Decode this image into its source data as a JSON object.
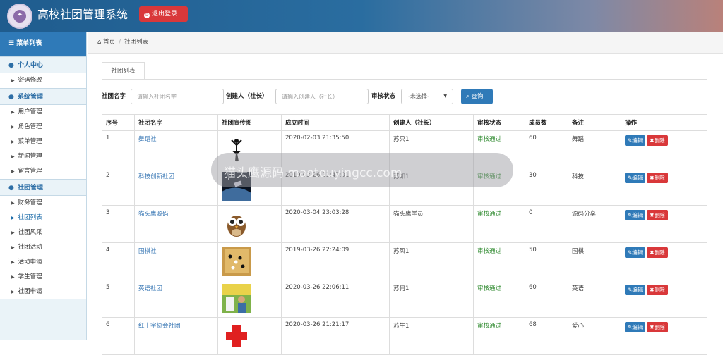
{
  "header": {
    "title": "高校社团管理系统",
    "logout_label": "退出登录"
  },
  "sidebar": {
    "menu_title": "菜单列表",
    "groups": [
      {
        "label": "个人中心",
        "items": [
          "密码修改"
        ]
      },
      {
        "label": "系统管理",
        "items": [
          "用户管理",
          "角色管理",
          "菜单管理",
          "新闻管理",
          "留言管理"
        ]
      },
      {
        "label": "社团管理",
        "items": [
          "财务管理",
          "社团列表",
          "社团风采",
          "社团活动",
          "活动申请",
          "学生管理",
          "社团申请"
        ]
      }
    ]
  },
  "breadcrumb": {
    "home": "首页",
    "current": "社团列表"
  },
  "tab_label": "社团列表",
  "search": {
    "name_label": "社团名字",
    "name_placeholder": "请输入社团名字",
    "creator_label": "创建人（社长）",
    "creator_placeholder": "请输入创建人（社长）",
    "status_label": "审核状态",
    "status_value": "-未选择-",
    "button_label": "查询"
  },
  "table": {
    "headers": [
      "序号",
      "社团名字",
      "社团宣传图",
      "成立时间",
      "创建人（社长）",
      "审核状态",
      "成员数",
      "备注",
      "操作"
    ],
    "edit_label": "编辑",
    "delete_label": "删除",
    "rows": [
      {
        "no": "1",
        "name": "舞蹈社",
        "date": "2020-02-03 21:35:50",
        "creator": "苏只1",
        "status": "审核通过",
        "members": "60",
        "remark": "舞蹈",
        "pic": "ballet"
      },
      {
        "no": "2",
        "name": "科技创新社团",
        "date": "2019-03-26 21:47:01",
        "creator": "苏如1",
        "status": "审核通过",
        "members": "30",
        "remark": "科技",
        "pic": "space"
      },
      {
        "no": "3",
        "name": "猫头鹰源码",
        "date": "2020-03-04 23:03:28",
        "creator": "猫头鹰学员",
        "status": "审核通过",
        "members": "0",
        "remark": "源码分享",
        "pic": "owl"
      },
      {
        "no": "4",
        "name": "围棋社",
        "date": "2019-03-26 22:24:09",
        "creator": "苏风1",
        "status": "审核通过",
        "members": "50",
        "remark": "围棋",
        "pic": "go"
      },
      {
        "no": "5",
        "name": "英语社团",
        "date": "2020-03-26 22:06:11",
        "creator": "苏何1",
        "status": "审核通过",
        "members": "60",
        "remark": "英语",
        "pic": "english"
      },
      {
        "no": "6",
        "name": "红十字协会社团",
        "date": "2020-03-26 21:21:17",
        "creator": "苏生1",
        "status": "审核通过",
        "members": "68",
        "remark": "爱心",
        "pic": "redcross"
      }
    ]
  },
  "watermark": "猫头鹰源码 maotouyingcc.com"
}
